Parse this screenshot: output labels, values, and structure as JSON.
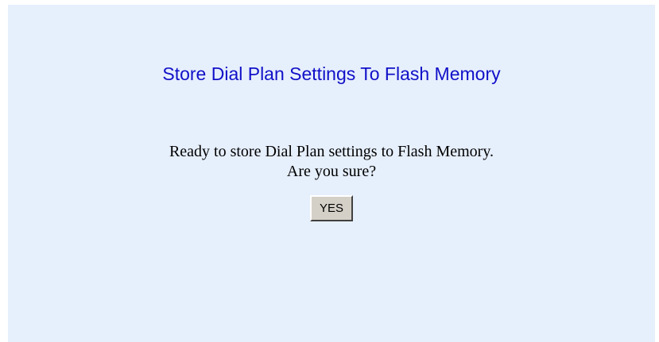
{
  "page": {
    "title": "Store Dial Plan Settings To Flash Memory",
    "message_line1": "Ready to store Dial Plan settings to Flash Memory.",
    "message_line2": "Are you sure?",
    "yes_label": "YES"
  },
  "colors": {
    "panel_background": "#e6effc",
    "title_color": "#1010c8",
    "button_face": "#d4d0c8"
  }
}
